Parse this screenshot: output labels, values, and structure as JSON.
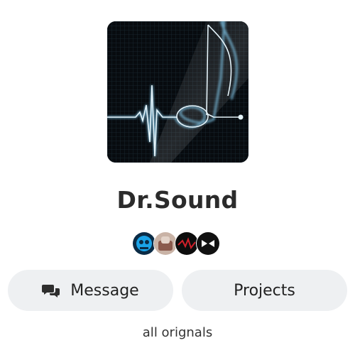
{
  "profile": {
    "name": "Dr.Sound",
    "bio": "all orignals"
  },
  "actions": {
    "message_label": "Message",
    "projects_label": "Projects"
  },
  "icons": {
    "message": "chat-bubbles-icon"
  },
  "colors": {
    "button_bg": "#eef0f2",
    "text": "#2b2b2b",
    "cover_line": "#cfe6f2"
  }
}
